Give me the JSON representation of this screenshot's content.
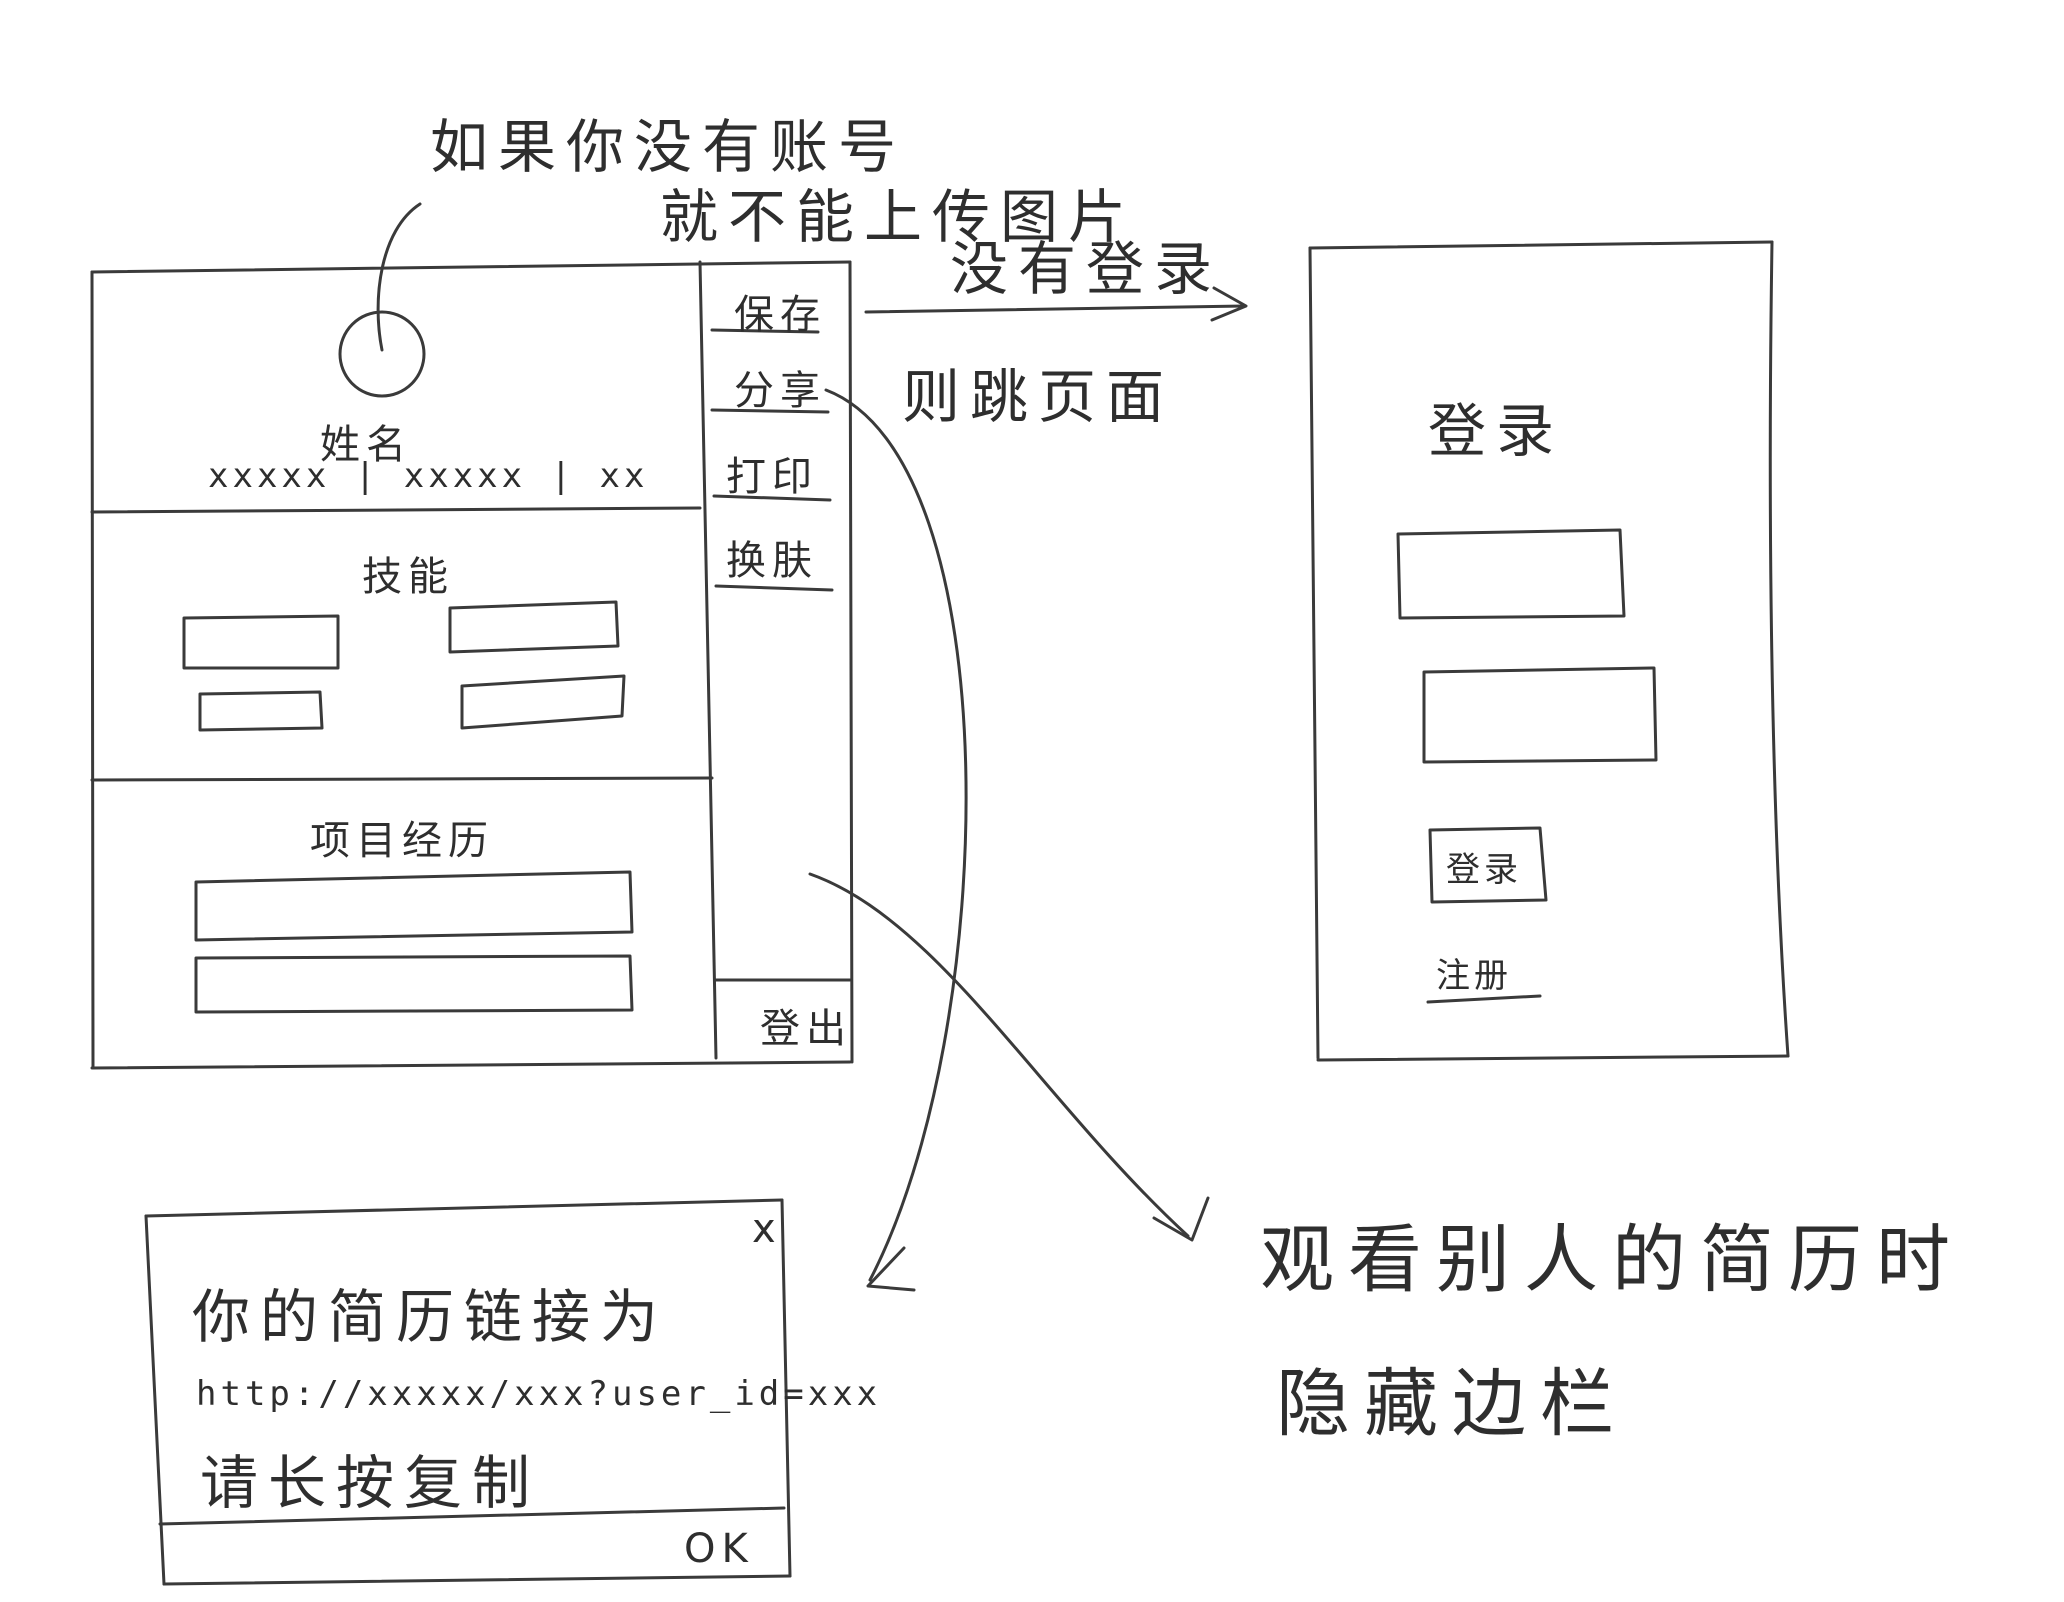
{
  "annotations": {
    "avatar_note_line1": "如果你没有账号",
    "avatar_note_line2": "就不能上传图片",
    "redirect_note_line1": "没有登录",
    "redirect_note_line2": "则跳页面",
    "hide_sidebar_line1": "观看别人的简历时",
    "hide_sidebar_line2": "隐藏边栏"
  },
  "resume_page": {
    "name_label": "姓名",
    "info_line": "xxxxx | xxxxx | xx",
    "skills_label": "技能",
    "projects_label": "项目经历"
  },
  "sidebar": {
    "items": [
      {
        "label": "保存"
      },
      {
        "label": "分享"
      },
      {
        "label": "打印"
      },
      {
        "label": "换肤"
      }
    ],
    "logout_label": "登出"
  },
  "login_page": {
    "title": "登录",
    "submit_label": "登录",
    "register_label": "注册"
  },
  "share_dialog": {
    "close_label": "x",
    "line1": "你的简历链接为",
    "url": "http://xxxxx/xxx?user_id=xxx",
    "line3": "请长按复制",
    "ok_label": "OK"
  }
}
